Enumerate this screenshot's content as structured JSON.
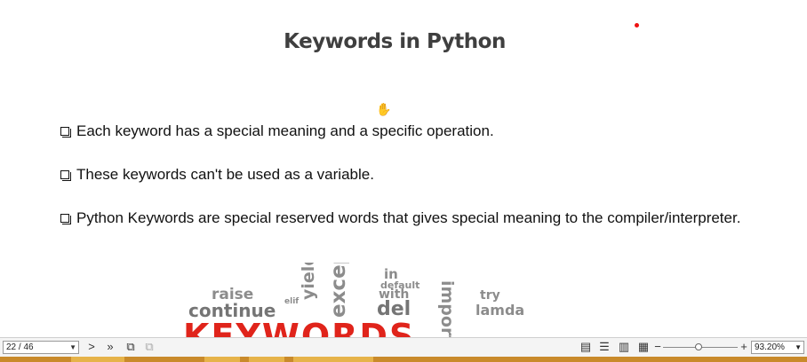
{
  "slide": {
    "title": "Keywords in Python",
    "bullets": [
      "Each keyword has a special meaning and a specific operation.",
      "These keywords can't be used as a variable.",
      "Python Keywords are special reserved words that gives special meaning to the compiler/interpreter."
    ],
    "wordcloud": [
      "in",
      "default",
      "with",
      "del",
      "import",
      "try",
      "lamda",
      "raise",
      "yield",
      "elif",
      "continue",
      "except",
      "KEYWORDS"
    ]
  },
  "viewer": {
    "page_indicator": "22 / 46",
    "zoom_level": "93.20%",
    "zoom_fraction": 0.48
  },
  "icons": {
    "next": "next-page-icon",
    "last": "last-page-icon",
    "copy": "copy-icon",
    "view_modes": [
      "single-page-icon",
      "continuous-page-icon",
      "facing-page-icon",
      "thumbnail-icon"
    ],
    "zoom_out": "zoom-out-icon",
    "zoom_in": "zoom-in-icon",
    "cursor": "hand-cursor-icon"
  },
  "colors": {
    "accent_red": "#e0241b",
    "title": "#3f3f3f"
  }
}
